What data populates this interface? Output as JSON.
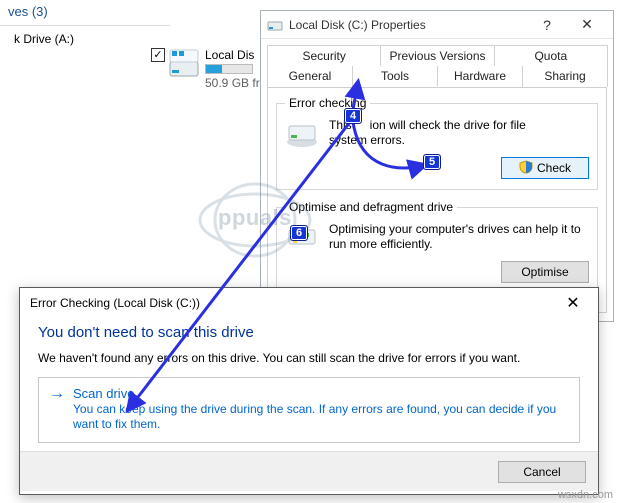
{
  "explorer": {
    "group_label": "ves (3)",
    "drive_a_label": "k Drive (A:)",
    "item": {
      "name": "Local Dis",
      "free": "50.9 GB fr"
    }
  },
  "properties": {
    "title": "Local Disk (C:) Properties",
    "tabs_top": [
      "Security",
      "Previous Versions",
      "Quota"
    ],
    "tabs_bottom": [
      "General",
      "Tools",
      "Hardware",
      "Sharing"
    ],
    "active_tab": "Tools",
    "error_checking": {
      "legend": "Error checking",
      "text_line1": "This",
      "text_gap": "ion will check the drive for file",
      "text_line2": "system errors.",
      "button": "Check"
    },
    "optimise": {
      "legend": "Optimise and defragment drive",
      "text": "Optimising your computer's drives can help it to run more efficiently.",
      "button": "Optimise"
    }
  },
  "error_dialog": {
    "title": "Error Checking (Local Disk (C:))",
    "heading": "You don't need to scan this drive",
    "sub": "We haven't found any errors on this drive. You can still scan the drive for errors if you want.",
    "scan_title": "Scan drive",
    "scan_desc": "You can keep using the drive during the scan. If any errors are found, you can decide if you want to fix them.",
    "cancel": "Cancel"
  },
  "annotations": {
    "b4": "4",
    "b5": "5",
    "b6": "6"
  },
  "watermark": "wsxdn.com",
  "brand": "ppuals"
}
